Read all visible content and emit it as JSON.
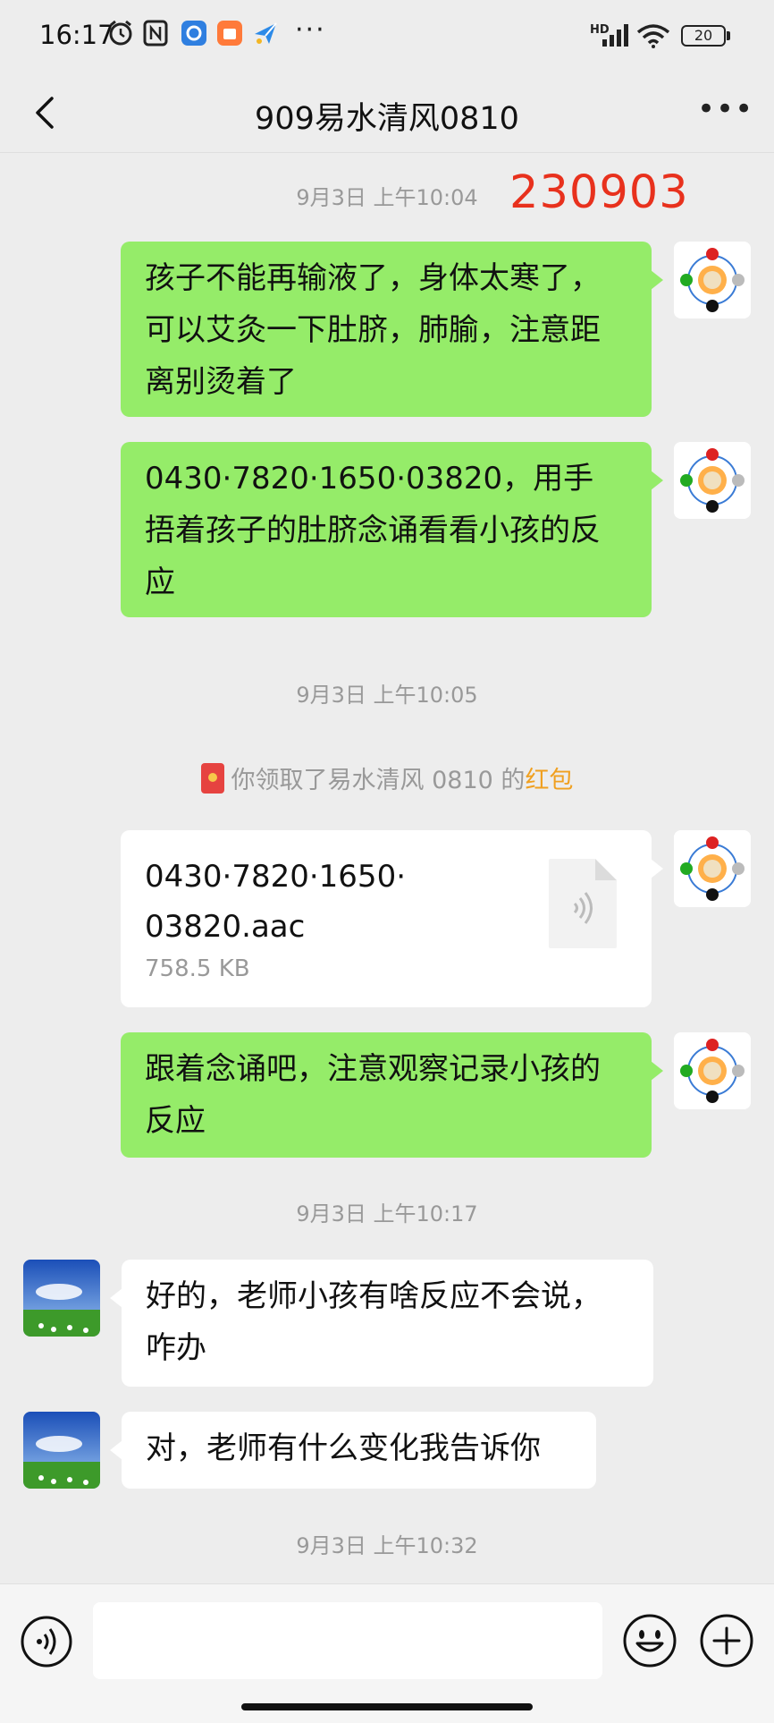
{
  "status_bar": {
    "time": "16:17",
    "battery": "20",
    "network": "HD",
    "icons": [
      "alarm-icon",
      "nfc-icon",
      "app-icon-blue",
      "app-icon-orange",
      "app-icon-plane",
      "more-dots-icon",
      "signal-icon",
      "wifi-icon",
      "battery-icon"
    ]
  },
  "header": {
    "title": "909易水清风0810",
    "back_icon": "chevron-left-icon",
    "more_icon": "more-horizontal-icon"
  },
  "messages": {
    "ts1": "9月3日 上午10:04",
    "stamp_code": "230903",
    "m1": [
      "孩子不能再输液了，身体太寒了，",
      "可以艾灸一下肚脐，肺腧，注意距",
      "离别烫着了"
    ],
    "m2": [
      "0430·7820·1650·03820，用手",
      "捂着孩子的肚脐念诵看看小孩的反",
      "应"
    ],
    "ts2": "9月3日 上午10:05",
    "system": {
      "prefix": "你领取了易水清风 0810 的",
      "highlight": "红包"
    },
    "file": {
      "name_lines": [
        "0430·7820·1650·",
        "03820.aac"
      ],
      "size": "758.5 KB"
    },
    "m3": [
      "跟着念诵吧，注意观察记录小孩的",
      "反应"
    ],
    "ts3": "9月3日 上午10:17",
    "m4": [
      "好的，老师小孩有啥反应不会说，",
      "咋办"
    ],
    "m5": [
      "对，老师有什么变化我告诉你"
    ],
    "ts4": "9月3日 上午10:32"
  },
  "colors": {
    "background": "#ededed",
    "my_bubble": "#95ec69",
    "other_bubble": "#ffffff",
    "stamp_red": "#e8311d",
    "highlight_orange": "#f0a020"
  },
  "input_bar": {
    "voice_icon": "voice-icon",
    "emoji_icon": "emoji-icon",
    "plus_icon": "plus-icon"
  }
}
